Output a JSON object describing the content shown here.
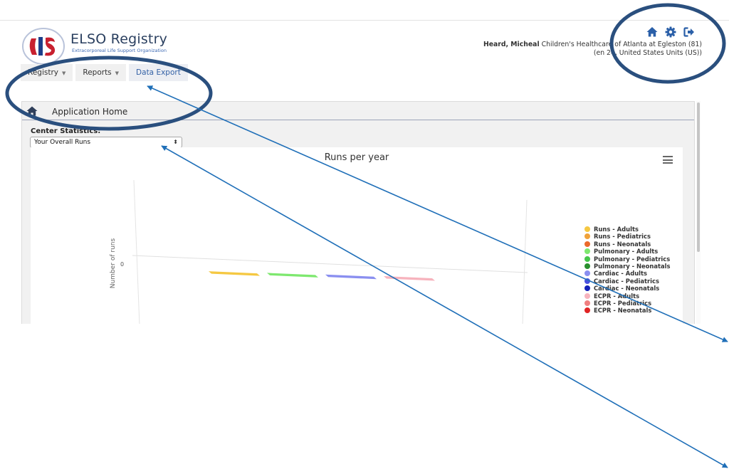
{
  "header": {
    "logo_title": "ELSO Registry",
    "logo_subtitle": "Extracorporeal Life Support Organization",
    "icons": [
      "home-icon",
      "gear-icon",
      "sign-out-icon"
    ],
    "user_name": "Heard, Micheal",
    "center_name": "Children's Healthcare of Atlanta at Egleston (81)",
    "locale_line": "(en 24, United States Units (US))"
  },
  "nav": {
    "registry": "Registry",
    "reports": "Reports",
    "data_export": "Data Export"
  },
  "panel": {
    "title": "Application Home",
    "stats_label": "Center Statistics:",
    "select_value": "Your Overall Runs"
  },
  "chart_data": {
    "type": "bar",
    "title": "Runs per year",
    "ylabel": "Number of runs",
    "y_ticks": [
      "0"
    ],
    "series": [
      {
        "name": "Runs - Adults",
        "color": "#f5c842",
        "values": [
          0
        ]
      },
      {
        "name": "Runs - Pediatrics",
        "color": "#f0a23a",
        "values": [
          0
        ]
      },
      {
        "name": "Runs - Neonatals",
        "color": "#eb6a2b",
        "values": [
          0
        ]
      },
      {
        "name": "Pulmonary - Adults",
        "color": "#7ee86f",
        "values": [
          0
        ]
      },
      {
        "name": "Pulmonary - Pediatrics",
        "color": "#45c64a",
        "values": [
          0
        ]
      },
      {
        "name": "Pulmonary - Neonatals",
        "color": "#2a8f2e",
        "values": [
          0
        ]
      },
      {
        "name": "Cardiac - Adults",
        "color": "#8a8ff0",
        "values": [
          0
        ]
      },
      {
        "name": "Cardiac - Pediatrics",
        "color": "#4a50e0",
        "values": [
          0
        ]
      },
      {
        "name": "Cardiac - Neonatals",
        "color": "#1420b8",
        "values": [
          0
        ]
      },
      {
        "name": "ECPR - Adults",
        "color": "#f7b3bd",
        "values": [
          0
        ]
      },
      {
        "name": "ECPR - Pediatrics",
        "color": "#f07f80",
        "values": [
          0
        ]
      },
      {
        "name": "ECPR - Neonatals",
        "color": "#e02424",
        "values": [
          0
        ]
      }
    ],
    "legend_position": "right"
  },
  "annotation_colors": {
    "ellipse": "#2a4f7e",
    "arrow": "#1f6fb8"
  }
}
